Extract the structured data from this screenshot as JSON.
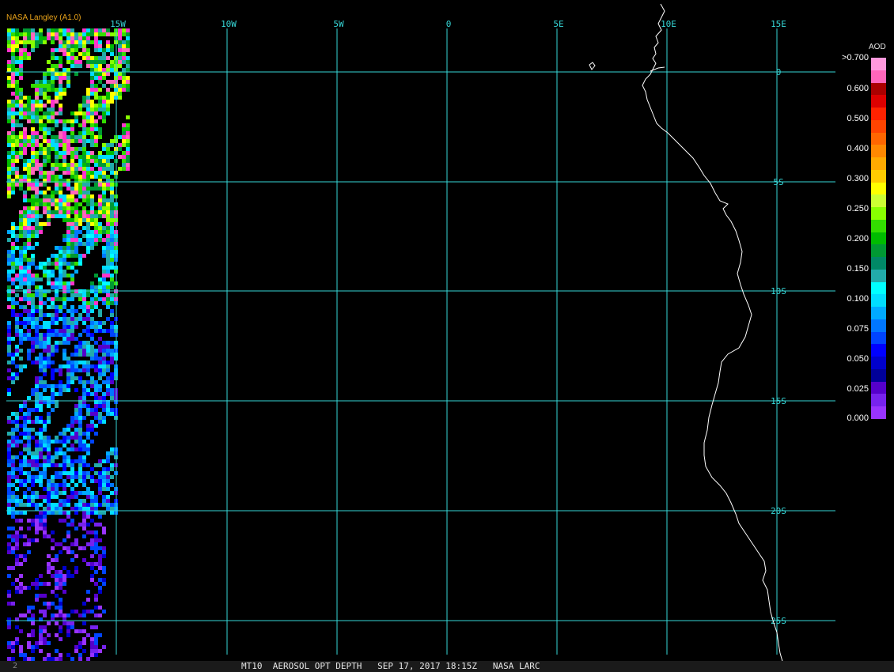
{
  "credit": "NASA Langley (A1.0)",
  "status_bar": {
    "left_mark": "2",
    "text": "MT10  AEROSOL OPT DEPTH   SEP 17, 2017 18:15Z   NASA LARC"
  },
  "map": {
    "lon_labels": [
      "15W",
      "10W",
      "5W",
      "0",
      "5E",
      "10E",
      "15E"
    ],
    "lat_labels": [
      "0",
      "5S",
      "10S",
      "15S",
      "20S",
      "25S"
    ],
    "grid_color": "#36d6d6",
    "coast_color": "#ffffff"
  },
  "legend": {
    "title": "AOD",
    "labels": [
      ">0.700",
      "0.600",
      "0.500",
      "0.400",
      "0.300",
      "0.250",
      "0.200",
      "0.150",
      "0.100",
      "0.075",
      "0.050",
      "0.025",
      "0.000"
    ],
    "colors": [
      "#ff99dd",
      "#ff66bb",
      "#aa0000",
      "#dd0000",
      "#ff2200",
      "#ff4400",
      "#ff6600",
      "#ff8800",
      "#ffaa00",
      "#ffcc00",
      "#ffff00",
      "#ccff33",
      "#88ff00",
      "#33dd00",
      "#00bb00",
      "#009933",
      "#008866",
      "#22aaaa",
      "#00ffff",
      "#00ddff",
      "#00aaff",
      "#0077ff",
      "#0044ff",
      "#0000ff",
      "#0000cc",
      "#000099",
      "#5500cc",
      "#7722ee",
      "#9933ff"
    ]
  }
}
